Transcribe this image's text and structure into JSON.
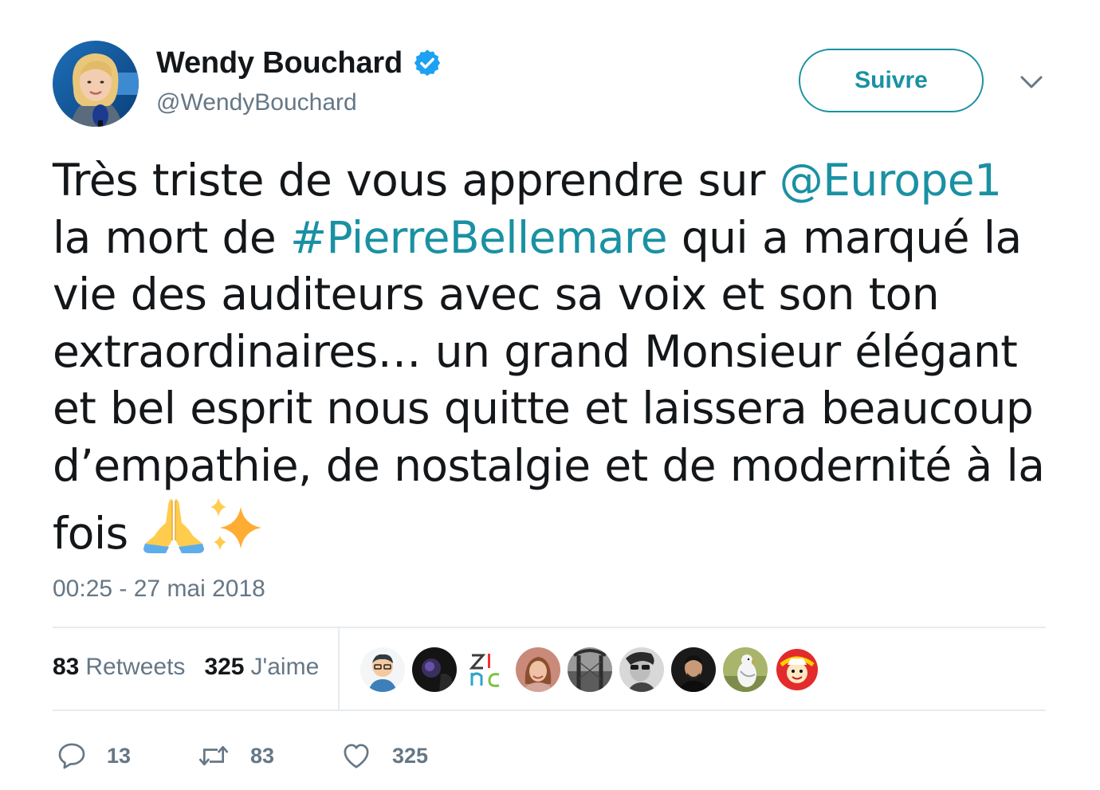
{
  "header": {
    "display_name": "Wendy Bouchard",
    "handle": "@WendyBouchard",
    "follow_label": "Suivre",
    "avatar_icon": "profile-photo",
    "verified_icon": "verified-badge-icon"
  },
  "tweet": {
    "text_before_mention": "Très triste de vous apprendre sur ",
    "mention": "@Europe1",
    "text_after_mention": " la mort de ",
    "hashtag": "#PierreBellemare",
    "text_after_hashtag": " qui a marqué la vie des auditeurs avec sa voix et son ton extraordinaires… un grand Monsieur élégant et bel esprit nous quitte et laissera beaucoup d’empathie, de nostalgie et de modernité à la fois ",
    "emojis": [
      "folded-hands-emoji",
      "sparkles-emoji"
    ],
    "timestamp": "00:25 - 27 mai 2018"
  },
  "stats": {
    "retweets_count": "83",
    "retweets_label": "Retweets",
    "likes_count": "325",
    "likes_label": "J'aime"
  },
  "actions": {
    "replies_count": "13",
    "retweets_count": "83",
    "likes_count": "325"
  },
  "colors": {
    "accent": "#1a91a3",
    "verified": "#1da1f2",
    "muted": "#657786",
    "text": "#14171a",
    "divider": "#e6ecf0"
  }
}
